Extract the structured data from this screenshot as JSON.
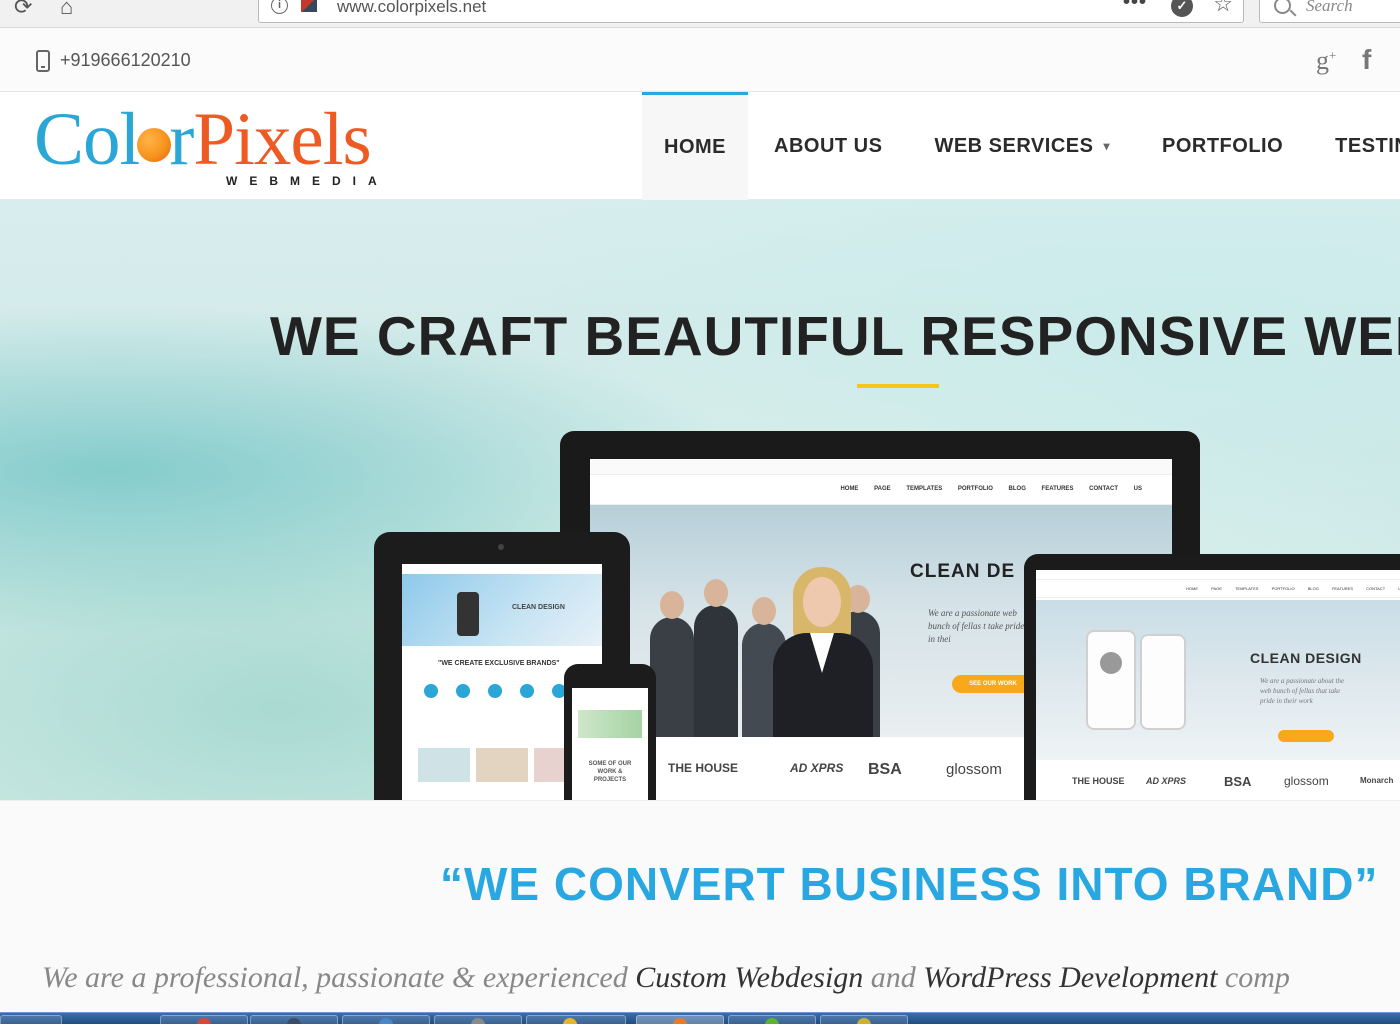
{
  "browser": {
    "url": "www.colorpixels.net",
    "search_placeholder": "Search"
  },
  "contact": {
    "phone": "+919666120210"
  },
  "logo": {
    "part1": "Col",
    "part2": "r",
    "part3": "Pixels",
    "subtitle": "WEBMEDIA"
  },
  "nav": {
    "items": [
      {
        "label": "HOME"
      },
      {
        "label": "ABOUT US"
      },
      {
        "label": "WEB SERVICES"
      },
      {
        "label": "PORTFOLIO"
      },
      {
        "label": "TESTIN"
      }
    ]
  },
  "hero": {
    "title": "WE CRAFT BEAUTIFUL RESPONSIVE WEBS",
    "monitor": {
      "nav_text": "HOME PAGE TEMPLATES PORTFOLIO BLOG FEATURES CONTACT US",
      "heading": "CLEAN DE",
      "body": "We are a passionate web bunch of fellas t take pride in thei",
      "button": "SEE OUR WORK",
      "brands": [
        "THE HOUSE",
        "AD XPRS",
        "BSA",
        "glossom"
      ]
    },
    "tablet": {
      "heading": "CLEAN DESIGN",
      "title": "\"WE CREATE EXCLUSIVE BRANDS\""
    },
    "phone": {
      "text": "SOME OF OUR WORK & PROJECTS"
    },
    "laptop": {
      "nav_text": "HOME PAGE TEMPLATES PORTFOLIO BLOG FEATURES CONTACT US",
      "heading": "CLEAN DESIGN",
      "body": "We are a passionate about the web bunch of fellas that take pride in their work",
      "brands": [
        "THE HOUSE",
        "AD XPRS",
        "BSA",
        "glossom",
        "Monarch"
      ]
    }
  },
  "tagline": {
    "title": "“WE CONVERT BUSINESS INTO BRAND”",
    "intro_1": "We are a professional, passionate & experienced ",
    "intro_2": "Custom Webdesign",
    "intro_3": " and ",
    "intro_4": "WordPress Development",
    "intro_5": " comp"
  },
  "colors": {
    "accent": "#29a7e1",
    "logo_orange": "#ee5a24",
    "underline": "#f5c518",
    "button": "#f7a81b"
  }
}
